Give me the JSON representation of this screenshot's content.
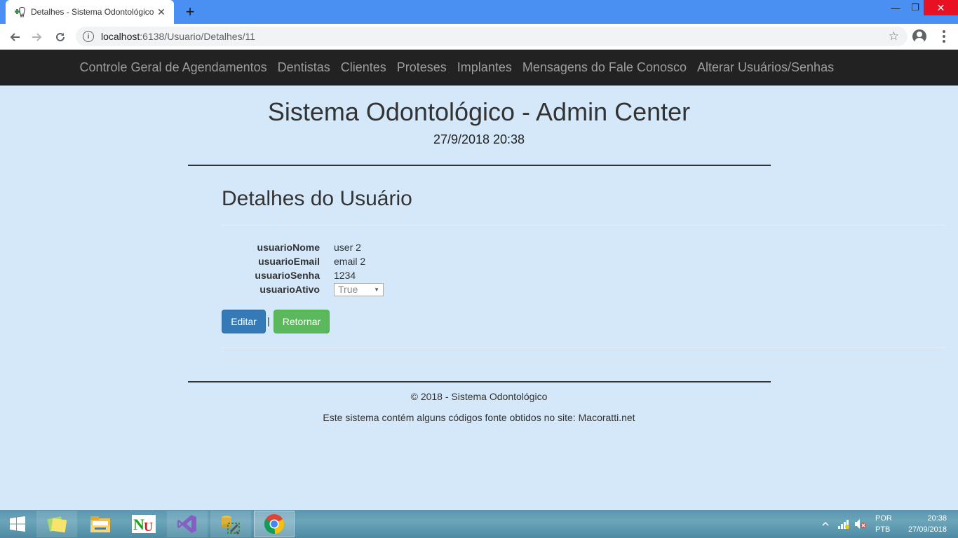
{
  "browser": {
    "tab_title": "Detalhes - Sistema Odontológico",
    "tab_close": "✕",
    "new_tab": "+",
    "url_host": "localhost",
    "url_path": ":6138/Usuario/Detalhes/11",
    "window_min": "—",
    "window_max": "❐",
    "window_close": "✕"
  },
  "navbar": {
    "items": [
      {
        "label": "Controle Geral de Agendamentos"
      },
      {
        "label": "Dentistas"
      },
      {
        "label": "Clientes"
      },
      {
        "label": "Proteses"
      },
      {
        "label": "Implantes"
      },
      {
        "label": "Mensagens do Fale Conosco"
      },
      {
        "label": "Alterar Usuários/Senhas"
      }
    ]
  },
  "header": {
    "title": "Sistema Odontológico - Admin Center",
    "datetime": "27/9/2018 20:38"
  },
  "details": {
    "heading": "Detalhes do Usuário",
    "fields": [
      {
        "label": "usuarioNome",
        "value": "user 2"
      },
      {
        "label": "usuarioEmail",
        "value": "email 2"
      },
      {
        "label": "usuarioSenha",
        "value": "1234"
      },
      {
        "label": "usuarioAtivo",
        "value": "True"
      }
    ],
    "edit_label": "Editar",
    "separator": "|",
    "back_label": "Retornar"
  },
  "footer": {
    "copyright": "© 2018 - Sistema Odontológico",
    "note": "Este sistema contém alguns códigos fonte obtidos no site: Macoratti.net"
  },
  "taskbar": {
    "lang_top": "POR",
    "lang_bottom": "PTB",
    "time": "20:38",
    "date": "27/09/2018",
    "apps": [
      {
        "name": "file-explorer-icon"
      },
      {
        "name": "nunit-icon"
      },
      {
        "name": "visual-studio-icon"
      },
      {
        "name": "sql-tools-icon"
      },
      {
        "name": "chrome-icon"
      }
    ]
  },
  "colors": {
    "page_background": "#d4e8f9",
    "navbar_background": "#222222",
    "primary_button": "#337ab7",
    "success_button": "#5cb85c",
    "tabstrip": "#4a90f2",
    "close_button": "#e81123"
  }
}
